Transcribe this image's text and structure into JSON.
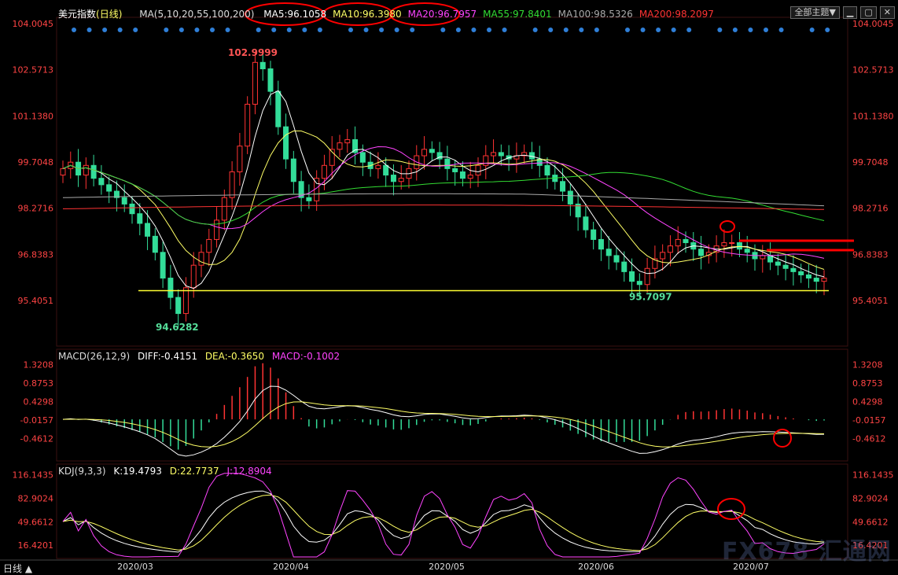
{
  "top_bar": {
    "title": "美元指数",
    "period_tag": "(日线)",
    "ma_label": "MA(5,10,20,55,100,200)",
    "ma_items": [
      {
        "text": "MA5:96.1058",
        "color": "#ffffff"
      },
      {
        "text": "MA10:96.3980",
        "color": "#ffff66"
      },
      {
        "text": "MA20:96.7957",
        "color": "#ff44ff"
      },
      {
        "text": "MA55:97.8401",
        "color": "#33dd33"
      },
      {
        "text": "MA100:98.5326",
        "color": "#aaaaaa"
      },
      {
        "text": "MA200:98.2097",
        "color": "#ff3333"
      }
    ],
    "theme_button": "全部主题",
    "theme_arrow": "▼"
  },
  "macd_bar": {
    "label": "MACD(26,12,9)",
    "diff": "DIFF:-0.4151",
    "dea": "DEA:-0.3650",
    "macd": "MACD:-0.1002"
  },
  "kdj_bar": {
    "label": "KDJ(9,3,3)",
    "k": "K:19.4793",
    "d": "D:22.7737",
    "j": "J:12.8904"
  },
  "bottom": {
    "period": "日线",
    "arrow": "▲"
  },
  "watermark": "FX678 汇通网",
  "colors": {
    "bull": "#ff3333",
    "bear": "#33dd99",
    "ma5": "#ffffff",
    "ma10": "#ffff66",
    "ma20": "#ff44ff",
    "ma55": "#33dd33",
    "ma100": "#aaaaaa",
    "ma200": "#ff3333",
    "axis_text": "#ff4444",
    "support": "#ffff33",
    "annotation": "#ff0000"
  },
  "chart_data": [
    {
      "type": "candlestick",
      "title": "美元指数 (日线)",
      "x_ticks": [
        "2020/03",
        "2020/04",
        "2020/05",
        "2020/06",
        "2020/07"
      ],
      "y_ticks": [
        "104.0045",
        "102.5713",
        "101.1380",
        "99.7048",
        "98.2716",
        "96.8383",
        "95.4051"
      ],
      "ylim": [
        95.4051,
        104.0045
      ],
      "high_label": "102.9999",
      "low_label": "94.6282",
      "support_label": "95.7097",
      "high_value": 102.9999,
      "low_value": 94.6282,
      "support_value": 95.7097,
      "close": [
        99.5,
        99.7,
        99.3,
        99.6,
        99.2,
        99.0,
        98.8,
        98.6,
        98.4,
        98.1,
        97.8,
        97.4,
        96.9,
        96.1,
        95.5,
        95.0,
        95.8,
        96.5,
        96.9,
        97.3,
        97.9,
        98.6,
        99.4,
        100.2,
        101.5,
        102.8,
        102.6,
        101.9,
        100.8,
        99.8,
        99.1,
        98.6,
        98.5,
        99.2,
        99.6,
        100.1,
        100.3,
        100.4,
        100.0,
        99.7,
        99.5,
        99.6,
        99.3,
        99.1,
        99.2,
        99.5,
        99.9,
        100.1,
        100.0,
        99.8,
        99.5,
        99.4,
        99.2,
        99.3,
        99.6,
        99.9,
        100.0,
        99.9,
        99.8,
        99.9,
        100.0,
        99.8,
        99.6,
        99.3,
        99.1,
        98.8,
        98.4,
        98.0,
        97.6,
        97.3,
        97.0,
        96.8,
        96.6,
        96.3,
        96.0,
        95.9,
        96.4,
        96.7,
        96.9,
        97.1,
        97.3,
        97.2,
        97.0,
        96.8,
        96.9,
        97.1,
        97.2,
        97.2,
        97.0,
        96.9,
        96.7,
        96.8,
        96.6,
        96.5,
        96.4,
        96.3,
        96.2,
        96.1,
        96.0,
        96.1
      ],
      "lines": [
        {
          "name": "MA5",
          "color_key": "ma5"
        },
        {
          "name": "MA10",
          "color_key": "ma10"
        },
        {
          "name": "MA20",
          "color_key": "ma20"
        },
        {
          "name": "MA55",
          "color_key": "ma55"
        },
        {
          "name": "MA100",
          "color_key": "ma100"
        },
        {
          "name": "MA200",
          "color_key": "ma200"
        }
      ]
    },
    {
      "type": "macd",
      "y_ticks": [
        "1.3208",
        "0.8753",
        "0.4298",
        "-0.0157",
        "-0.4612"
      ],
      "ylim": [
        -0.7,
        1.35
      ]
    },
    {
      "type": "kdj",
      "y_ticks": [
        "116.1435",
        "82.9024",
        "49.6612",
        "16.4201"
      ],
      "ylim": [
        0,
        120
      ]
    }
  ]
}
